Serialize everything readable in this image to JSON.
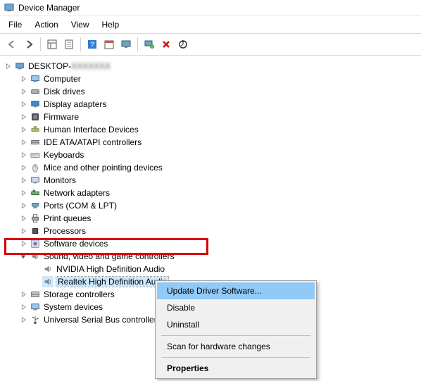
{
  "window": {
    "title": "Device Manager"
  },
  "menu": {
    "file": "File",
    "action": "Action",
    "view": "View",
    "help": "Help"
  },
  "tree": {
    "root_prefix": "DESKTOP-",
    "root_suffix": "XXXXXXX",
    "nodes": [
      {
        "label": "Computer",
        "icon": "computer",
        "depth": 1,
        "collapsed": true
      },
      {
        "label": "Disk drives",
        "icon": "disk",
        "depth": 1,
        "collapsed": true
      },
      {
        "label": "Display adapters",
        "icon": "display",
        "depth": 1,
        "collapsed": true
      },
      {
        "label": "Firmware",
        "icon": "firmware",
        "depth": 1,
        "collapsed": true
      },
      {
        "label": "Human Interface Devices",
        "icon": "hid",
        "depth": 1,
        "collapsed": true
      },
      {
        "label": "IDE ATA/ATAPI controllers",
        "icon": "ide",
        "depth": 1,
        "collapsed": true
      },
      {
        "label": "Keyboards",
        "icon": "keyboard",
        "depth": 1,
        "collapsed": true
      },
      {
        "label": "Mice and other pointing devices",
        "icon": "mouse",
        "depth": 1,
        "collapsed": true
      },
      {
        "label": "Monitors",
        "icon": "monitor",
        "depth": 1,
        "collapsed": true
      },
      {
        "label": "Network adapters",
        "icon": "network",
        "depth": 1,
        "collapsed": true
      },
      {
        "label": "Ports (COM & LPT)",
        "icon": "ports",
        "depth": 1,
        "collapsed": true
      },
      {
        "label": "Print queues",
        "icon": "printer",
        "depth": 1,
        "collapsed": true
      },
      {
        "label": "Processors",
        "icon": "cpu",
        "depth": 1,
        "collapsed": true
      },
      {
        "label": "Software devices",
        "icon": "software",
        "depth": 1,
        "collapsed": true
      },
      {
        "label": "Sound, video and game controllers",
        "icon": "sound",
        "depth": 1,
        "collapsed": false
      },
      {
        "label": "NVIDIA High Definition Audio",
        "icon": "speaker",
        "depth": 2,
        "collapsed": null
      },
      {
        "label": "Realtek High Definition Audio",
        "icon": "speaker",
        "depth": 2,
        "collapsed": null,
        "selected": true
      },
      {
        "label": "Storage controllers",
        "icon": "storage",
        "depth": 1,
        "collapsed": true
      },
      {
        "label": "System devices",
        "icon": "system",
        "depth": 1,
        "collapsed": true
      },
      {
        "label": "Universal Serial Bus controllers",
        "icon": "usb",
        "depth": 1,
        "collapsed": true,
        "truncate": true
      }
    ]
  },
  "contextMenu": {
    "items": [
      {
        "label": "Update Driver Software...",
        "selected": true
      },
      {
        "label": "Disable"
      },
      {
        "label": "Uninstall"
      },
      {
        "sep": true
      },
      {
        "label": "Scan for hardware changes"
      },
      {
        "sep": true
      },
      {
        "label": "Properties",
        "bold": true
      }
    ]
  },
  "toolbar_icons": [
    "back",
    "forward",
    "|",
    "show-tree",
    "properties-sheet",
    "|",
    "help",
    "calendar",
    "monitor-refresh",
    "|",
    "monitor-plus",
    "delete-x",
    "update-driver"
  ]
}
